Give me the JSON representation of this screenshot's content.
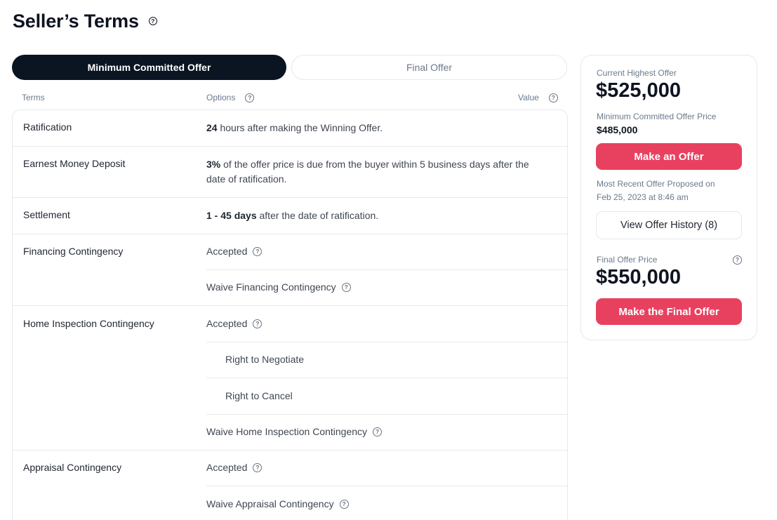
{
  "page": {
    "title": "Seller’s Terms"
  },
  "tabs": [
    {
      "label": "Minimum Committed Offer"
    },
    {
      "label": "Final Offer"
    }
  ],
  "columns": {
    "terms": "Terms",
    "options": "Options",
    "value": "Value"
  },
  "terms": {
    "ratification": {
      "name": "Ratification",
      "bold": "24",
      "text": " hours after making the Winning Offer."
    },
    "earnest": {
      "name": "Earnest Money Deposit",
      "bold": "3%",
      "text": " of the offer price is due from the buyer within 5 business days after the",
      "text2": "date of ratification."
    },
    "settlement": {
      "name": "Settlement",
      "bold": "1 - 45 days",
      "text": " after the date of ratification."
    },
    "financing": {
      "name": "Financing Contingency",
      "opt1": "Accepted",
      "opt2": "Waive Financing Contingency"
    },
    "inspection": {
      "name": "Home Inspection Contingency",
      "opt1": "Accepted",
      "sub1": "Right to Negotiate",
      "sub2": "Right to Cancel",
      "opt2": "Waive Home Inspection Contingency"
    },
    "appraisal": {
      "name": "Appraisal Contingency",
      "opt1": "Accepted",
      "opt2": "Waive Appraisal Contingency"
    }
  },
  "sidebar": {
    "current_label": "Current Highest Offer",
    "current_value": "$525,000",
    "min_label": "Minimum Committed Offer Price",
    "min_value": "$485,000",
    "make_offer": "Make an Offer",
    "recent_line1": "Most Recent Offer Proposed on",
    "recent_line2": "Feb 25, 2023 at 8:46 am",
    "history_button": "View Offer History (8)",
    "final_label": "Final Offer Price",
    "final_value": "$550,000",
    "final_button": "Make the Final Offer"
  },
  "icons": {
    "help": "question-circle-icon"
  },
  "colors": {
    "primary_dark": "#0b1421",
    "accent_red": "#e8415f",
    "border": "#e6e8ec",
    "muted_text": "#6b7a8c"
  }
}
